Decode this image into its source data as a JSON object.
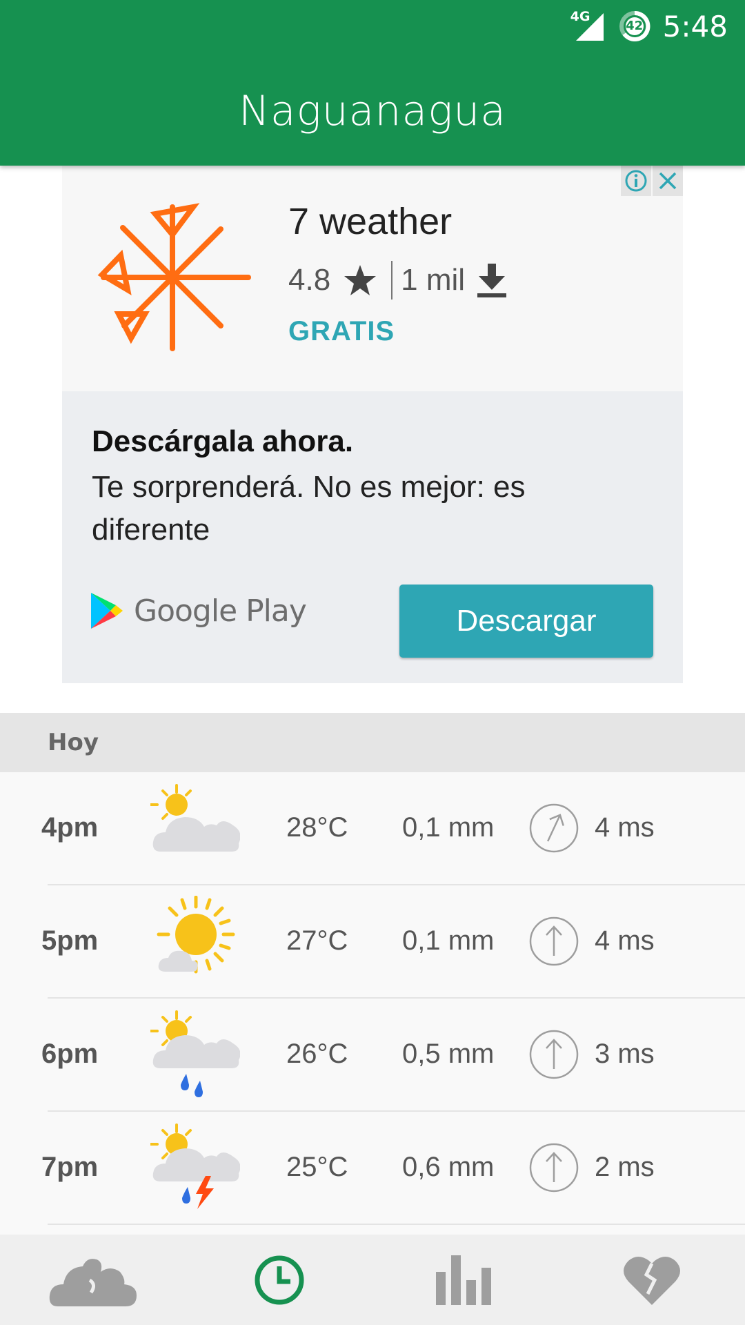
{
  "status_bar": {
    "network": "4G",
    "battery": "42",
    "time": "5:48"
  },
  "header": {
    "title": "Naguanagua"
  },
  "ad": {
    "app_name": "7 weather",
    "rating": "4.8",
    "downloads": "1 mil",
    "price": "GRATIS",
    "headline": "Descárgala ahora.",
    "body": "Te sorprenderá. No es mejor: es diferente",
    "store_label": "Google Play",
    "cta_label": "Descargar",
    "colors": {
      "accent": "#2ea6b4",
      "logo": "#ff6d12"
    }
  },
  "forecast": {
    "section_label": "Hoy",
    "rows": [
      {
        "hour": "4pm",
        "icon": "sun-cloud-icon",
        "temp": "28°C",
        "rain": "0,1 mm",
        "wind": "4 ms"
      },
      {
        "hour": "5pm",
        "icon": "sun-small-cloud-icon",
        "temp": "27°C",
        "rain": "0,1 mm",
        "wind": "4 ms"
      },
      {
        "hour": "6pm",
        "icon": "sun-rain-icon",
        "temp": "26°C",
        "rain": "0,5 mm",
        "wind": "3 ms"
      },
      {
        "hour": "7pm",
        "icon": "sun-storm-icon",
        "temp": "25°C",
        "rain": "0,6 mm",
        "wind": "2 ms"
      }
    ]
  },
  "bottom_nav": {
    "items": [
      {
        "icon": "weather-cloud-icon",
        "active": false
      },
      {
        "icon": "clock-icon",
        "active": true
      },
      {
        "icon": "bar-chart-icon",
        "active": false
      },
      {
        "icon": "heart-icon",
        "active": false
      }
    ],
    "colors": {
      "active": "#169150",
      "inactive": "#9e9e9e"
    }
  }
}
